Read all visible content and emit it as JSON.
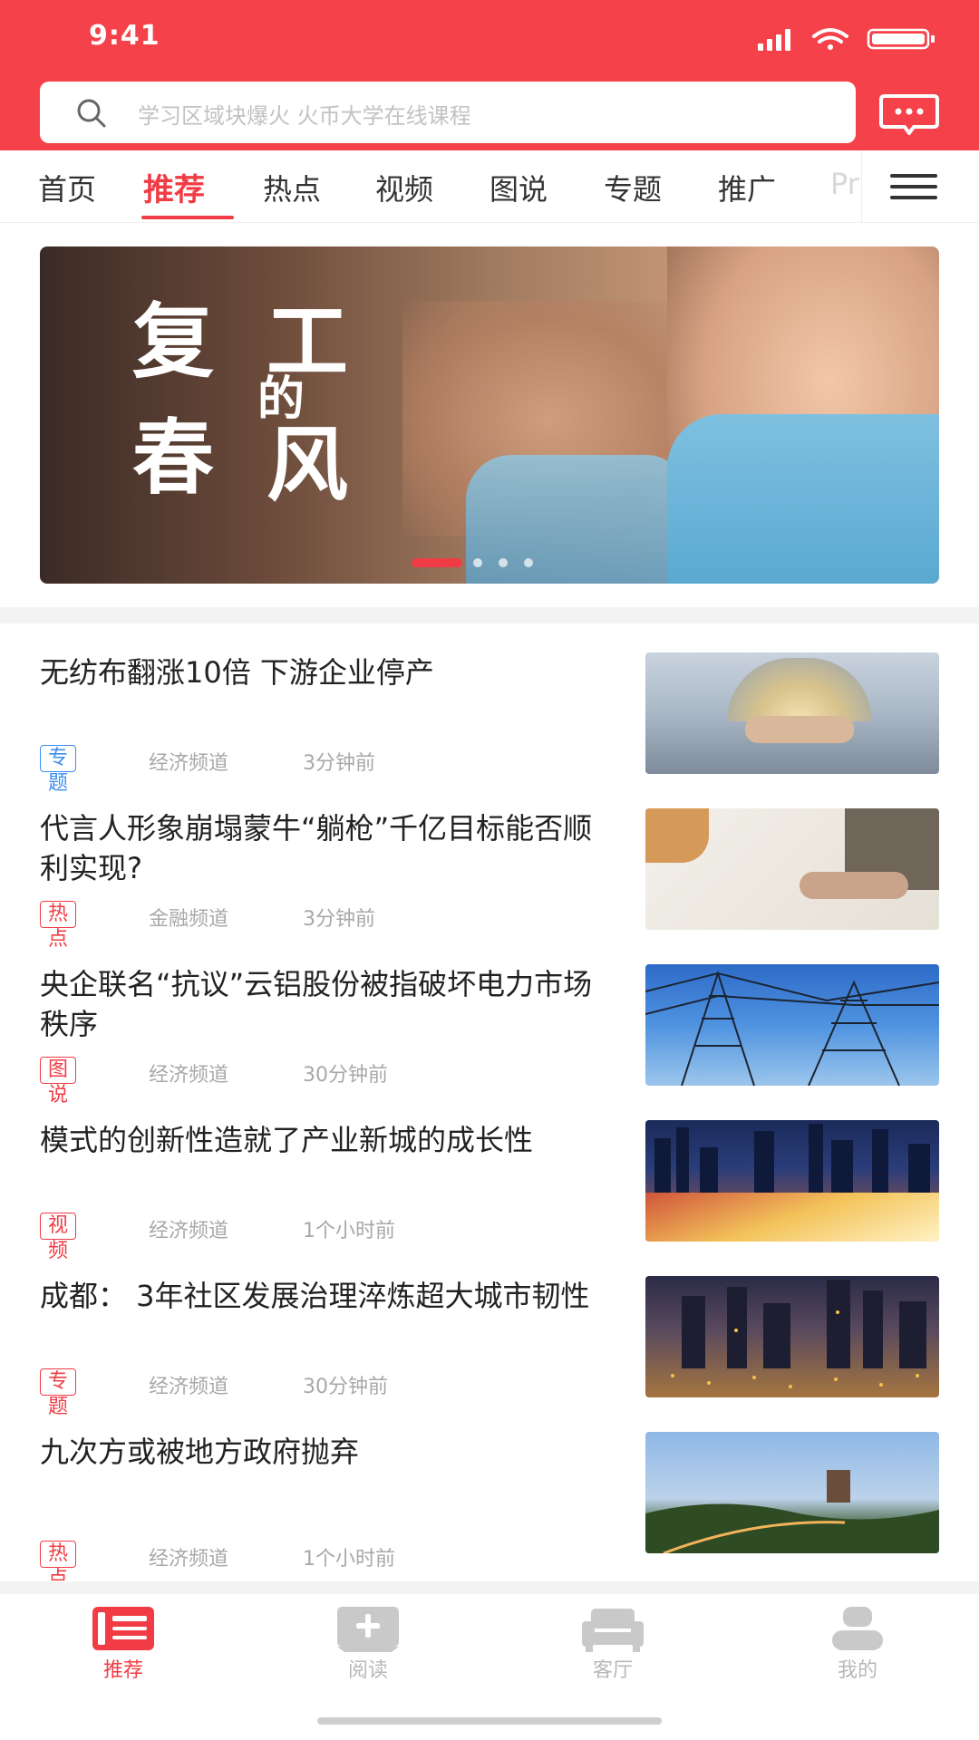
{
  "status_bar": {
    "time": "9:41"
  },
  "search": {
    "placeholder": "学习区域块爆火 火币大学在线课程"
  },
  "tabs": [
    {
      "label": "首页",
      "active": false
    },
    {
      "label": "推荐",
      "active": true
    },
    {
      "label": "热点",
      "active": false
    },
    {
      "label": "视频",
      "active": false
    },
    {
      "label": "图说",
      "active": false
    },
    {
      "label": "专题",
      "active": false
    },
    {
      "label": "推广",
      "active": false
    },
    {
      "label": "Pr",
      "active": false
    }
  ],
  "banner": {
    "title_chars": [
      "复",
      "工",
      "的",
      "春",
      "风"
    ],
    "slide_count": 4,
    "active_slide": 1
  },
  "news": [
    {
      "title": "无纺布翻涨10倍 下游企业停产",
      "tag": "专题",
      "channel": "经济频道",
      "time": "3分钟前"
    },
    {
      "title": "代言人形象崩塌蒙牛“躺枪”千亿目标能否顺利实现?",
      "tag": "热点",
      "channel": "金融频道",
      "time": "3分钟前"
    },
    {
      "title": "央企联名“抗议”云铝股份被指破坏电力市场秩序",
      "tag": "图说",
      "channel": "经济频道",
      "time": "30分钟前"
    },
    {
      "title": "模式的创新性造就了产业新城的成长性",
      "tag": "视频",
      "channel": "经济频道",
      "time": "1个小时前"
    },
    {
      "title": "成都： 3年社区发展治理淬炼超大城市韧性",
      "tag": "专题",
      "channel": "经济频道",
      "time": "30分钟前"
    },
    {
      "title": "九次方或被地方政府抛弃",
      "tag": "热点",
      "channel": "经济频道",
      "time": "1个小时前"
    }
  ],
  "bottom_tabs": [
    {
      "label": "推荐",
      "icon": "news-icon",
      "active": true
    },
    {
      "label": "阅读",
      "icon": "read-plus-icon",
      "active": false
    },
    {
      "label": "客厅",
      "icon": "sofa-icon",
      "active": false
    },
    {
      "label": "我的",
      "icon": "profile-icon",
      "active": false
    }
  ],
  "colors": {
    "accent": "#f13c45",
    "header": "#f5424a",
    "tag_blue": "#3d8ef0"
  }
}
